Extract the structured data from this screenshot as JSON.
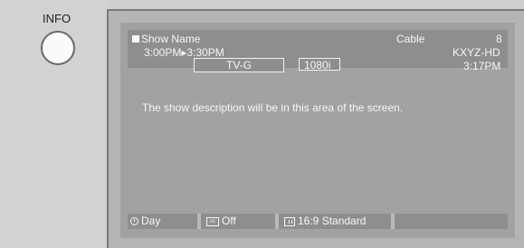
{
  "remote": {
    "info_label": "INFO"
  },
  "banner": {
    "show_name": "Show Name",
    "source": "Cable",
    "channel": "8",
    "time_range": "3:00PM▸3:30PM",
    "callsign": "KXYZ-HD",
    "rating": "TV-G",
    "resolution": "1080i",
    "current_time": "3:17PM"
  },
  "description": "The show description will be in this area of the screen.",
  "bottom_bar": {
    "day_label": "Day",
    "cc_label": "Off",
    "cc_icon_text": "cc",
    "aspect_label": "16:9 Standard"
  }
}
